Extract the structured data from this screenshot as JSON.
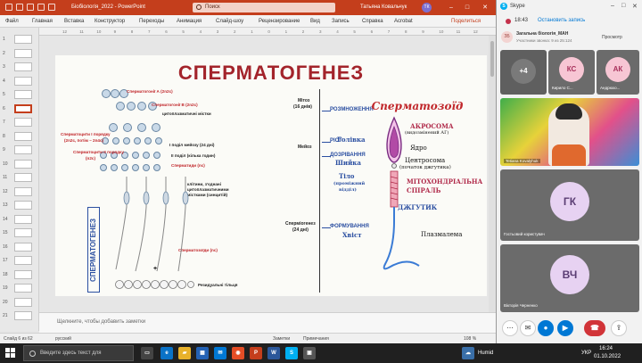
{
  "powerpoint": {
    "filename": "Біобіологія_2022  -  PowerPoint",
    "search_placeholder": "Поиск",
    "user": "Татьяна Ковальчук",
    "user_initials": "ТК",
    "menu": [
      "Файл",
      "Главная",
      "Вставка",
      "Конструктор",
      "Переходы",
      "Анимация",
      "Слайд-шоу",
      "Рецензирование",
      "Вид",
      "Запись",
      "Справка",
      "Acrobat"
    ],
    "share_label": "Поделиться",
    "ruler_ticks": [
      "12",
      "11",
      "10",
      "9",
      "8",
      "7",
      "6",
      "5",
      "4",
      "3",
      "2",
      "1",
      "0",
      "1",
      "2",
      "3",
      "4",
      "5",
      "6",
      "7",
      "8",
      "9",
      "10",
      "11",
      "12"
    ],
    "slide_numbers": [
      "1",
      "2",
      "3",
      "4",
      "5",
      "6",
      "7",
      "8",
      "9",
      "10",
      "11",
      "12",
      "13",
      "14",
      "15",
      "16",
      "17",
      "18",
      "19",
      "20",
      "21"
    ],
    "active_slide": 6,
    "notes_placeholder": "Щелкните, чтобы добавить заметки",
    "status": {
      "slide": "Слайд 6 из 62",
      "language": "русский",
      "notes": "Заметки",
      "comments": "Примечания",
      "zoom": "108 %"
    }
  },
  "slide": {
    "title": "СПЕРМАТОГЕНЕЗ",
    "left": {
      "spermatogonia_a": "Сперматогонії А (2n2c)",
      "spermatogonia_b": "Сперматогонії В (2n2c)",
      "cyto_bridges": "цитоплазматичні містки",
      "spermatocytes_1": "Сперматоцити І порядку",
      "spermatocytes_1_formula": "(2n2c, потім – 2n4c)",
      "meiosis_1": "І поділ мейозу (24 дні)",
      "spermatocytes_2": "Сперматоцити ІІ порядку",
      "spermatocytes_2_formula": "(n2c)",
      "meiosis_2": "ІІ поділ (кілька годин)",
      "spermatids": "Сперматиди (nc)",
      "syncytium_1": "клітини, з'єднані",
      "syncytium_2": "цитоплазматичними",
      "syncytium_3": "містками (синцитій)",
      "spermatozoa": "Сперматозоїди (nc)",
      "residual": "Резидуальні тільця",
      "plus": "+",
      "vertical": "СПЕРМАТОГЕНЕЗ"
    },
    "middle": {
      "mitosis": "Мітоз",
      "mitosis_days": "(16 днів)",
      "meiosis": "Мейоз",
      "spermiogenesis": "Спермiогенез",
      "spermiogenesis_days": "(24 дні)"
    },
    "phases": [
      "РОЗМНОЖЕННЯ",
      "РІСТ",
      "ДОЗРІВАННЯ",
      "ФОРМУВАННЯ"
    ],
    "sperm": {
      "title": "Сперматозоїд",
      "head": "Голівка",
      "acrosome": "АКРОСОМА",
      "acrosome_note": "(видозмінений АГ)",
      "nucleus": "Ядро",
      "centrosome": "Центросома",
      "centrosome_note": "(початок джгутика)",
      "neck": "Шийка",
      "body": "Тіло",
      "body_note_1": "(проміжний",
      "body_note_2": "відділ)",
      "mito_1": "МІТОХОНДРІАЛЬНА",
      "mito_2": "СПІРАЛЬ",
      "flagellum": "ДЖГУТИК",
      "tail": "Хвіст",
      "plasma": "Плазмалема"
    }
  },
  "skype": {
    "app": "Skype",
    "time": "18:43",
    "stop_recording": "Остановить запись",
    "group_name": "Загальна біологія_МАН",
    "group_sub": "Участники звонка: 9 из 25:124",
    "group_initials": "ЗБ",
    "view_label": "Просмотр",
    "participants": [
      {
        "initials": "+4",
        "name": ""
      },
      {
        "initials": "КС",
        "name": "Кирило С..."
      },
      {
        "initials": "АК",
        "name": "Андрюхо..."
      },
      {
        "initials": "",
        "name": "Tetiana Kovalyhuk"
      },
      {
        "initials": "ГК",
        "name": "Гостьовий користувач"
      },
      {
        "initials": "ВЧ",
        "name": "Вікторія Черненко"
      }
    ],
    "colors": {
      "accent": "#0078d4",
      "hangup": "#d13438",
      "avatar_pink": "#f7c6d4",
      "avatar_purple": "#e7d2f2"
    }
  },
  "taskbar": {
    "search_placeholder": "Введите здесь текст для",
    "weather": "Humid",
    "lang": "УКР",
    "time": "16:24",
    "date": "01.10.2022"
  }
}
